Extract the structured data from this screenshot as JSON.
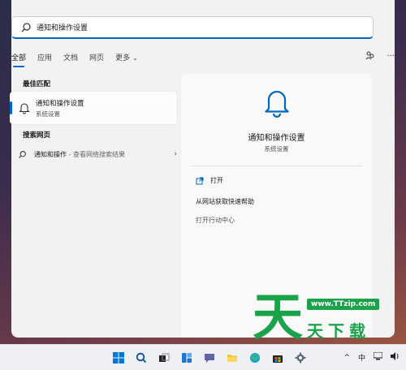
{
  "search": {
    "value": "通知和操作设置"
  },
  "tabs": [
    {
      "label": "全部"
    },
    {
      "label": "应用"
    },
    {
      "label": "文档"
    },
    {
      "label": "网页"
    },
    {
      "label": "更多"
    }
  ],
  "sections": {
    "best_match": "最佳匹配",
    "search_web": "搜索网页"
  },
  "best_match": {
    "title": "通知和操作设置",
    "subtitle": "系统设置"
  },
  "web_result": {
    "query": "通知和操作",
    "suffix": " - 查看网络搜索结果"
  },
  "detail": {
    "title": "通知和操作设置",
    "subtitle": "系统设置",
    "actions": [
      {
        "label": "打开"
      },
      {
        "label": "从网站获取快速帮助"
      },
      {
        "label": "打开行动中心"
      }
    ]
  },
  "watermark": {
    "url": "www.TTzip.com",
    "chars": "天下载",
    "logo": "天"
  },
  "tray": {
    "ime": "中"
  },
  "colors": {
    "accent": "#0067c0",
    "watermark": "#1aa34a"
  }
}
